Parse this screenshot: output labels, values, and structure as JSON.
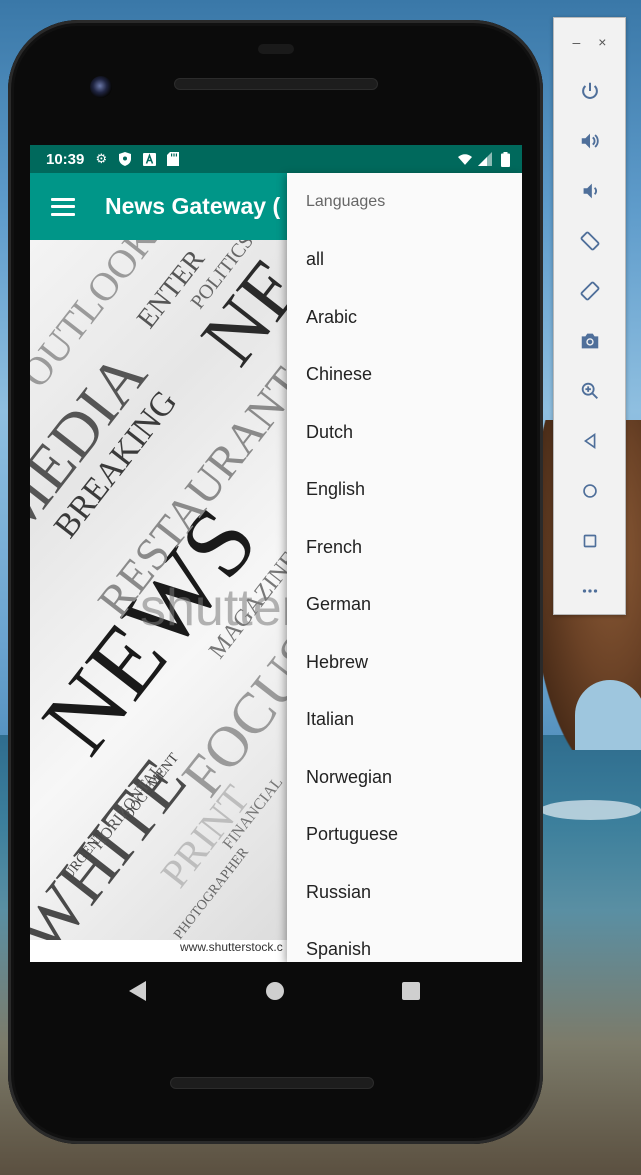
{
  "status_bar": {
    "time": "10:39",
    "left_icons": [
      "gear-icon",
      "shield-icon",
      "a-box-icon",
      "sd-card-icon"
    ],
    "right_icons": [
      "wifi-icon",
      "signal-icon",
      "battery-icon"
    ]
  },
  "app_bar": {
    "title": "News Gateway (",
    "menu_icon": "hamburger-icon"
  },
  "background_image": {
    "watermark": "shutterst",
    "credit": "www.shutterstock.c"
  },
  "dropdown": {
    "header": "Languages",
    "items": [
      "all",
      "Arabic",
      "Chinese",
      "Dutch",
      "English",
      "French",
      "German",
      "Hebrew",
      "Italian",
      "Norwegian",
      "Portuguese",
      "Russian",
      "Spanish"
    ]
  },
  "emulator_toolbar": {
    "window_controls": [
      "–",
      "×"
    ],
    "buttons": [
      "power-icon",
      "volume-up-icon",
      "volume-down-icon",
      "rotate-left-icon",
      "rotate-right-icon",
      "camera-icon",
      "zoom-icon",
      "back-icon",
      "home-icon",
      "overview-icon",
      "more-icon"
    ]
  },
  "theme": {
    "primary": "#009688",
    "primary_dark": "#00695c"
  }
}
